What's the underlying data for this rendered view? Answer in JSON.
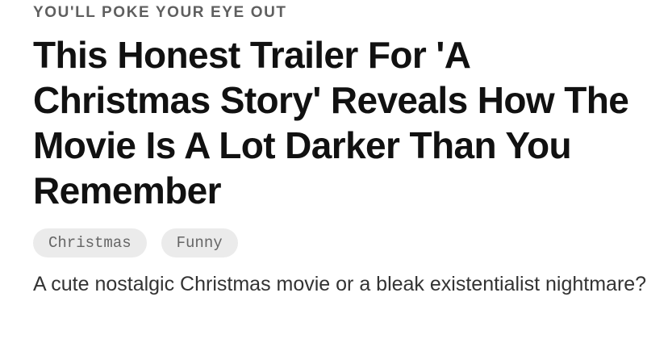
{
  "article": {
    "kicker": "YOU'LL POKE YOUR EYE OUT",
    "headline": "This Honest Trailer For 'A Christmas Story' Reveals How The Movie Is A Lot Darker Than You Remember",
    "tags": [
      "Christmas",
      "Funny"
    ],
    "dek": "A cute nostalgic Christmas movie or a bleak existentialist nightmare?"
  }
}
